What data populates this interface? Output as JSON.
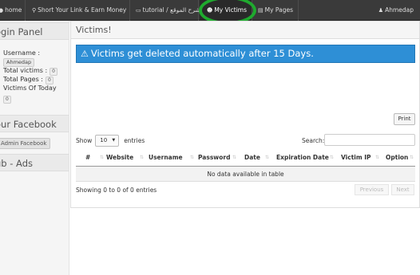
{
  "navbar": {
    "items": [
      {
        "icon": "●",
        "label": "home"
      },
      {
        "icon": "⚲",
        "label": "Short Your Link & Earn Money"
      },
      {
        "icon": "▭",
        "label": "tutorial / شرح الموقع"
      },
      {
        "icon": "☻",
        "label": "My Victims"
      },
      {
        "icon": "▤",
        "label": "My Pages"
      }
    ],
    "user_icon": "♟",
    "user": "Ahmedap"
  },
  "sidebar": {
    "login_title": "ogin Panel",
    "username_label": "Username :",
    "username_value": "Ahmedap",
    "total_victims_label": "Total victims :",
    "total_victims": "0",
    "total_pages_label": "Total Pages :",
    "total_pages": "0",
    "victims_today_label": "Victims Of Today",
    "victims_today": "0",
    "facebook_title": "our Facebook",
    "admin_facebook": "Admin Facebook",
    "ads_title": "ub - Ads"
  },
  "main": {
    "title": "Victims!",
    "alert": "Victims get deleted automatically after 15 Days.",
    "print": "Print",
    "show_label": "Show",
    "entries_value": "10",
    "entries_label": "entries",
    "search_label": "Search:",
    "columns": [
      "#",
      "Website",
      "Username",
      "Password",
      "Date",
      "Expiration Date",
      "Victim IP",
      "Option"
    ],
    "empty": "No data available in table",
    "info": "Showing 0 to 0 of 0 entries",
    "previous": "Previous",
    "next": "Next"
  }
}
